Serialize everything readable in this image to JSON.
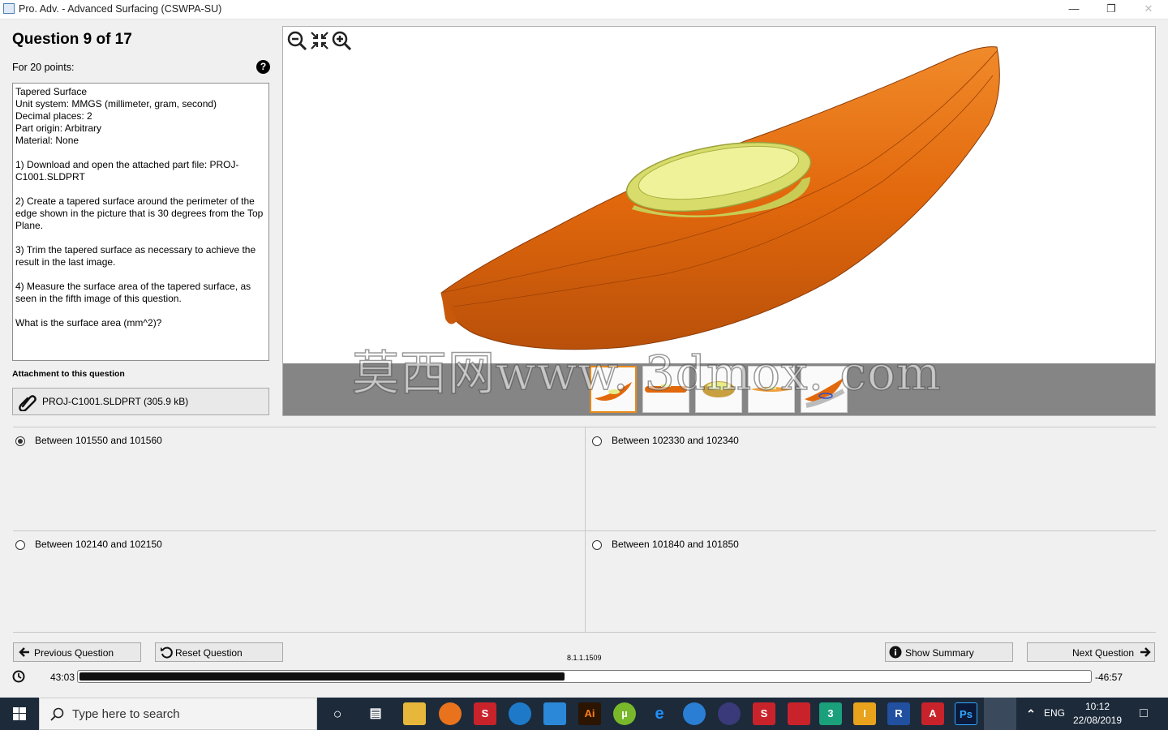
{
  "window": {
    "title": "Pro. Adv. - Advanced Surfacing (CSWPA-SU)"
  },
  "question": {
    "title": "Question 9 of 17",
    "points": "For 20 points:",
    "text": "Tapered Surface\nUnit system: MMGS (millimeter, gram, second)\nDecimal places: 2\nPart origin: Arbitrary\nMaterial: None\n\n1) Download and open the attached part file: PROJ-C1001.SLDPRT\n\n2) Create a tapered surface around the perimeter of the edge shown in the picture that is 30 degrees from the Top Plane.\n\n3) Trim the tapered surface as necessary to achieve the result in the last image.\n\n4) Measure the surface area of the tapered surface, as seen in the fifth image of this question.\n\nWhat is the surface area (mm^2)?"
  },
  "attachment": {
    "label": "Attachment to this question",
    "file": "PROJ-C1001.SLDPRT (305.9 kB)"
  },
  "viewer": {
    "watermark": "莫西网www. 3dmox. com",
    "thumbnails": 5,
    "selected_thumbnail": 1
  },
  "answers": [
    {
      "label": "Between 101550 and 101560",
      "selected": true
    },
    {
      "label": "Between 102330 and 102340",
      "selected": false
    },
    {
      "label": "Between 102140 and 102150",
      "selected": false
    },
    {
      "label": "Between 101840 and 101850",
      "selected": false
    }
  ],
  "nav": {
    "previous": "Previous Question",
    "reset": "Reset Question",
    "summary": "Show Summary",
    "next": "Next Question",
    "version": "8.1.1.1509"
  },
  "timer": {
    "elapsed": "43:03",
    "remaining": "-46:57",
    "progress": 0.48
  },
  "taskbar": {
    "search_placeholder": "Type here to search",
    "language": "ENG",
    "time": "10:12",
    "date": "22/08/2019"
  },
  "colors": {
    "kayak": "#e2680c",
    "cockpit": "#e6ec8a",
    "taskbar": "#1c2a3a"
  }
}
